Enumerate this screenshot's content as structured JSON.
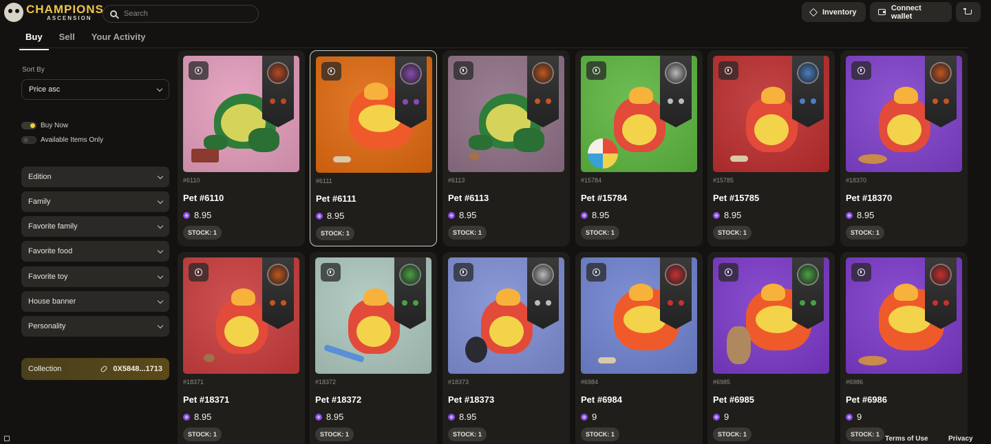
{
  "brand": {
    "title": "CHAMPIONS",
    "subtitle": "ASCENSION"
  },
  "search": {
    "placeholder": "Search"
  },
  "header": {
    "inventory": "Inventory",
    "connect_wallet": "Connect wallet"
  },
  "tabs": [
    {
      "label": "Buy",
      "active": true
    },
    {
      "label": "Sell",
      "active": false
    },
    {
      "label": "Your Activity",
      "active": false
    }
  ],
  "sidebar": {
    "sort_by_label": "Sort By",
    "sort_value": "Price asc",
    "toggles": [
      {
        "label": "Buy Now",
        "on": true
      },
      {
        "label": "Available Items Only",
        "on": false
      }
    ],
    "filters": [
      "Edition",
      "Family",
      "Favorite family",
      "Favorite food",
      "Favorite toy",
      "House banner",
      "Personality"
    ],
    "collection": {
      "label": "Collection",
      "address": "0X5848...1713"
    }
  },
  "cards": [
    {
      "edition": "#6110",
      "name": "Pet #6110",
      "price": "8.95",
      "stock": "STOCK: 1",
      "bg": "#e6a7c3",
      "creature": "frog",
      "toy": "book",
      "banner_color": "#b84a22"
    },
    {
      "edition": "#6111",
      "name": "Pet #6111",
      "price": "8.95",
      "stock": "STOCK: 1",
      "bg": "#e37a2a",
      "creature": "fox",
      "toy": "bone",
      "banner_color": "#8a4bb0"
    },
    {
      "edition": "#6113",
      "name": "Pet #6113",
      "price": "8.95",
      "stock": "STOCK: 1",
      "bg": "#9b8093",
      "creature": "frog",
      "toy": "cookie",
      "banner_color": "#c4561e"
    },
    {
      "edition": "#15784",
      "name": "Pet #15784",
      "price": "8.95",
      "stock": "STOCK: 1",
      "bg": "#6fbe55",
      "creature": "pup",
      "toy": "ball",
      "banner_color": "#bbbbbb"
    },
    {
      "edition": "#15785",
      "name": "Pet #15785",
      "price": "8.95",
      "stock": "STOCK: 1",
      "bg": "#c44545",
      "creature": "pup",
      "toy": "bone",
      "banner_color": "#4a7fc0"
    },
    {
      "edition": "#18370",
      "name": "Pet #18370",
      "price": "8.95",
      "stock": "STOCK: 1",
      "bg": "#8d55d0",
      "creature": "pup",
      "toy": "pie",
      "banner_color": "#c4561e"
    },
    {
      "edition": "#18371",
      "name": "Pet #18371",
      "price": "8.95",
      "stock": "STOCK: 1",
      "bg": "#cf5252",
      "creature": "pup",
      "toy": "cookie",
      "banner_color": "#c4561e"
    },
    {
      "edition": "#18372",
      "name": "Pet #18372",
      "price": "8.95",
      "stock": "STOCK: 1",
      "bg": "#b5cdc4",
      "creature": "pup",
      "toy": "sword",
      "banner_color": "#4aa045"
    },
    {
      "edition": "#18373",
      "name": "Pet #18373",
      "price": "8.95",
      "stock": "STOCK: 1",
      "bg": "#8c9ad8",
      "creature": "pup",
      "toy": "egg",
      "banner_color": "#bbbbbb"
    },
    {
      "edition": "#6984",
      "name": "Pet #6984",
      "price": "9",
      "stock": "STOCK: 1",
      "bg": "#8090d4",
      "creature": "fox",
      "toy": "bone",
      "banner_color": "#c83030"
    },
    {
      "edition": "#6985",
      "name": "Pet #6985",
      "price": "9",
      "stock": "STOCK: 1",
      "bg": "#8a4fcf",
      "creature": "fox",
      "toy": "bunny",
      "banner_color": "#4aa045"
    },
    {
      "edition": "#6986",
      "name": "Pet #6986",
      "price": "9",
      "stock": "STOCK: 1",
      "bg": "#8a4fcf",
      "creature": "fox",
      "toy": "pie",
      "banner_color": "#c83030"
    }
  ],
  "footer": {
    "terms": "Terms of Use",
    "privacy": "Privacy"
  }
}
